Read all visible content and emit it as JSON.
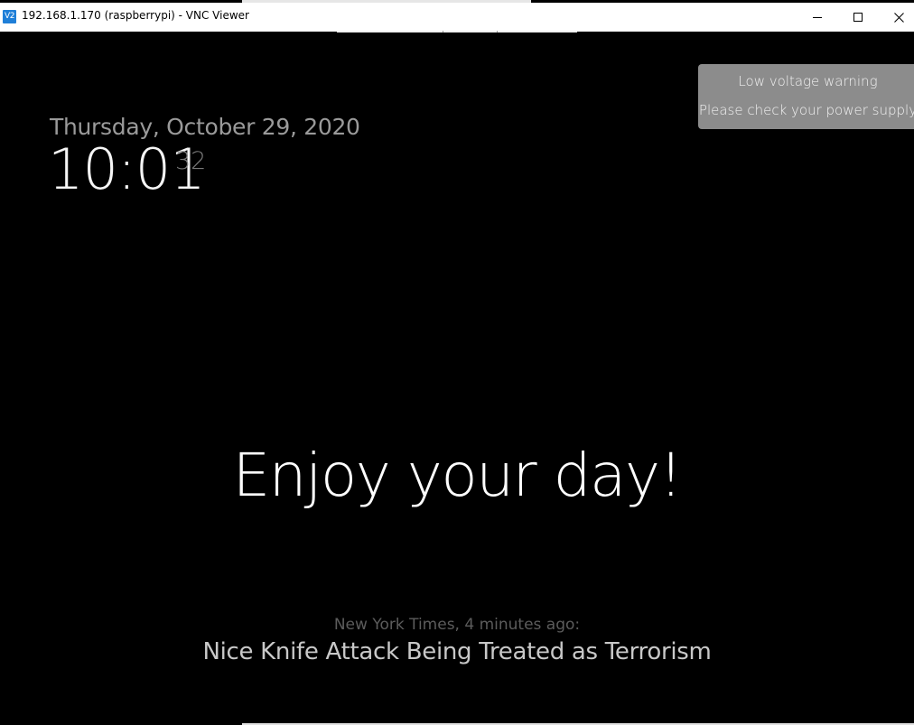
{
  "window": {
    "title": "192.168.1.170 (raspberrypi) - VNC Viewer",
    "app_icon": "V2",
    "icons": [
      "vnc-viewer-icon",
      "minimize-icon",
      "maximize-icon",
      "close-icon"
    ]
  },
  "notification": {
    "title": "Low voltage warning",
    "body": "Please check your power supply"
  },
  "clock": {
    "date": "Thursday, October 29, 2020",
    "time": "10:01",
    "seconds": "32"
  },
  "compliment": {
    "text": "Enjoy your day!"
  },
  "news": {
    "source": "New York Times, 4 minutes ago:",
    "headline": "Nice Knife Attack Being Treated as Terrorism"
  },
  "colors": {
    "background": "#000000",
    "notification_bg": "#8c8c8c",
    "date_text": "#9a9a9a",
    "seconds_text": "#7a7a7a",
    "news_source_text": "#5c5c5c",
    "app_icon_bg": "#1f7fd8"
  }
}
